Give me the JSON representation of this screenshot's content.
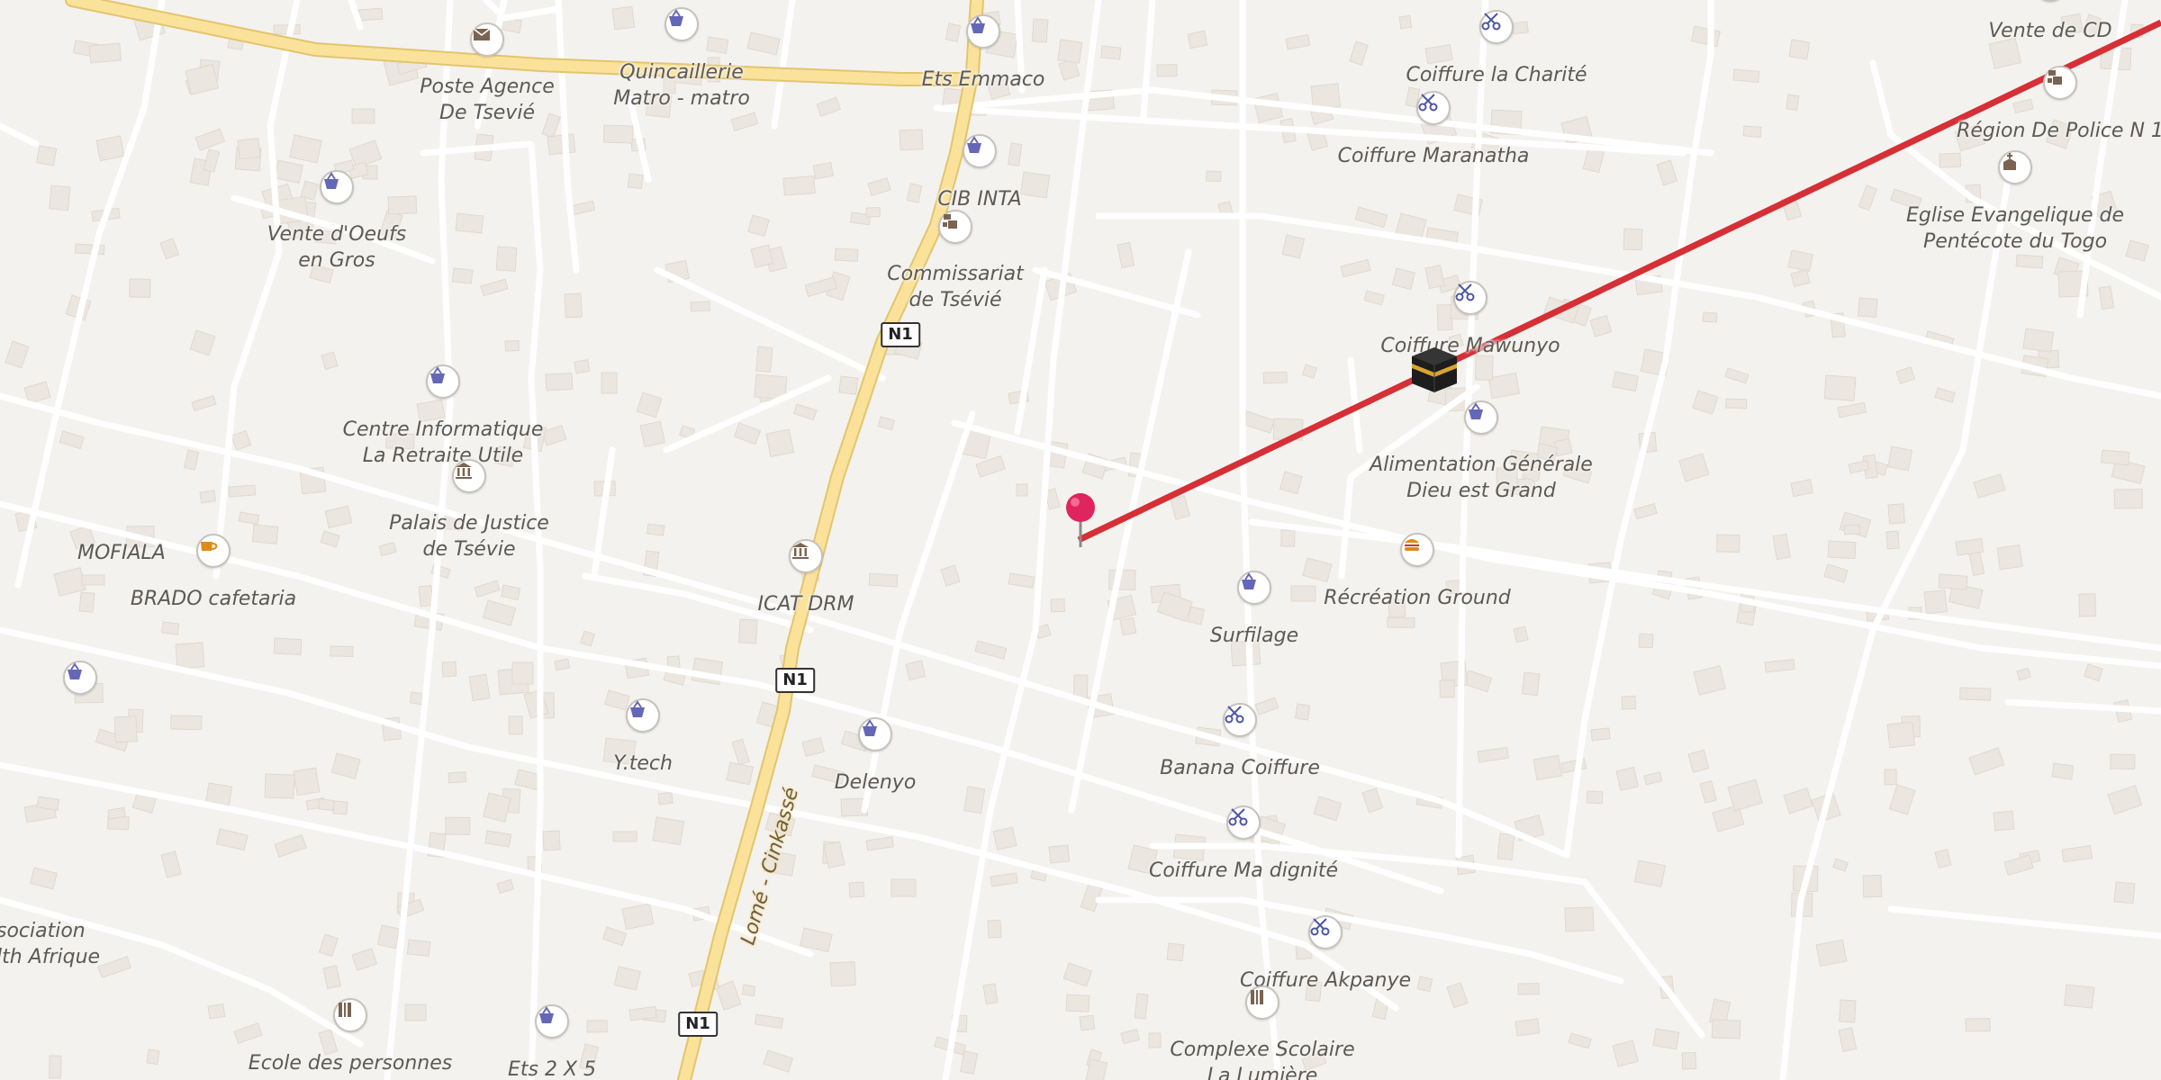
{
  "map": {
    "colors": {
      "background": "#f4f2ef",
      "minor_road": "#ffffff",
      "primary_road": "#fae29b",
      "primary_road_casing": "#e2c56d",
      "building": "#ebe6df",
      "route_line": "#d62f35",
      "shop_icon": "#6467b7",
      "hair_icon": "#4d55a8",
      "civic_icon": "#7a6451",
      "cafe_icon": "#e08a14",
      "label_text": "#5d5a56",
      "pin": "#e0245e"
    },
    "road_labels": {
      "main_road_name": "Lomé - Cinkassé"
    },
    "shields": [
      "N1",
      "N1",
      "N1",
      "N1"
    ],
    "pois": [
      {
        "icon": "mail-icon",
        "label": "Poste Agence\nDe Tsevié"
      },
      {
        "icon": "shopping-basket-icon",
        "label": "Quincaillerie\nMatro - matro"
      },
      {
        "icon": "shopping-basket-icon",
        "label": "Ets Emmaco"
      },
      {
        "icon": "scissors-icon",
        "label": "Coiffure la Charité"
      },
      {
        "icon": "shopping-basket-icon",
        "label": "Vente de CD"
      },
      {
        "icon": "police-icon",
        "label": "Région De Police N 1"
      },
      {
        "icon": "scissors-icon",
        "label": "Coiffure Maranatha"
      },
      {
        "icon": "shopping-basket-icon",
        "label": "CIB INTA"
      },
      {
        "icon": "church-icon",
        "label": "Eglise Evangelique de\nPentécote du Togo"
      },
      {
        "icon": "shopping-basket-icon",
        "label": "Vente d'Oeufs\nen Gros"
      },
      {
        "icon": "police-icon",
        "label": "Commissariat\nde Tsévié"
      },
      {
        "icon": "scissors-icon",
        "label": "Coiffure Mawunyo"
      },
      {
        "icon": "shopping-basket-icon",
        "label": "Centre Informatique\nLa Retraite Utile"
      },
      {
        "icon": "shopping-basket-icon",
        "label": "Alimentation Générale\nDieu est Grand"
      },
      {
        "icon": "courthouse-icon",
        "label": "Palais de Justice\nde Tsévie"
      },
      {
        "icon": "",
        "label": "MOFIALA"
      },
      {
        "icon": "cafe-icon",
        "label": "BRADO cafetaria"
      },
      {
        "icon": "courthouse-icon",
        "label": "ICAT DRM"
      },
      {
        "icon": "fast-food-icon",
        "label": "Récréation Ground"
      },
      {
        "icon": "shopping-basket-icon",
        "label": "Surfilage"
      },
      {
        "icon": "shopping-basket-icon",
        "label": ""
      },
      {
        "icon": "shopping-basket-icon",
        "label": "Y.tech"
      },
      {
        "icon": "shopping-basket-icon",
        "label": "Delenyo"
      },
      {
        "icon": "scissors-icon",
        "label": "Banana Coiffure"
      },
      {
        "icon": "scissors-icon",
        "label": "Coiffure Ma dignité"
      },
      {
        "icon": "",
        "label": "sociation\nlth Afrique"
      },
      {
        "icon": "scissors-icon",
        "label": "Coiffure Akpanye"
      },
      {
        "icon": "school-icon",
        "label": "Ecole des personnes"
      },
      {
        "icon": "shopping-basket-icon",
        "label": "Ets 2 X 5"
      },
      {
        "icon": "school-icon",
        "label": "Complexe Scolaire\nLa Lumière"
      }
    ],
    "markers": {
      "current_location": "map-pin-icon",
      "destination": "kaaba-icon"
    }
  }
}
